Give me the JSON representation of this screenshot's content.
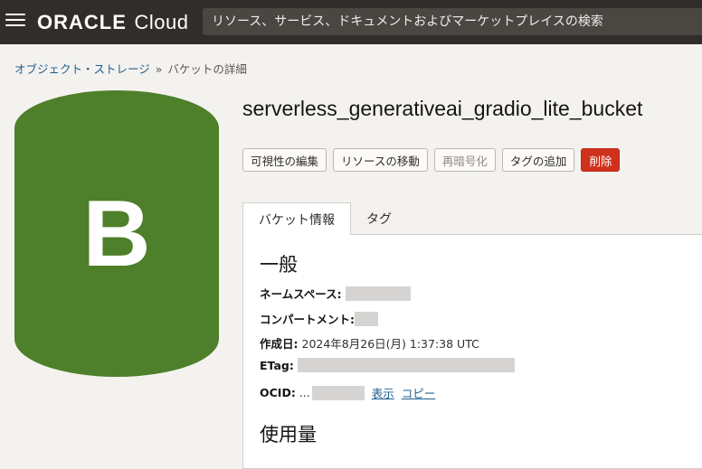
{
  "header": {
    "brand": "ORACLE",
    "product": "Cloud",
    "search_placeholder": "リソース、サービス、ドキュメントおよびマーケットプレイスの検索"
  },
  "breadcrumb": {
    "parent": "オブジェクト・ストレージ",
    "separator": "»",
    "current": "バケットの詳細"
  },
  "bucket": {
    "icon_letter": "B",
    "icon_color": "#4e7f2a",
    "name": "serverless_generativeai_gradio_lite_bucket"
  },
  "actions": {
    "edit_visibility": "可視性の編集",
    "move_resource": "リソースの移動",
    "reencrypt": "再暗号化",
    "add_tags": "タグの追加",
    "delete": "削除"
  },
  "tabs": [
    {
      "label": "バケット情報",
      "active": true
    },
    {
      "label": "タグ",
      "active": false
    }
  ],
  "general": {
    "title": "一般",
    "namespace_label": "ネームスペース:",
    "compartment_label": "コンパートメント:",
    "created_label": "作成日:",
    "created_value": "2024年8月26日(月) 1:37:38 UTC",
    "etag_label": "ETag:",
    "ocid_label": "OCID:",
    "ocid_prefix": "...",
    "show_link": "表示",
    "copy_link": "コピー"
  },
  "usage": {
    "title": "使用量"
  }
}
